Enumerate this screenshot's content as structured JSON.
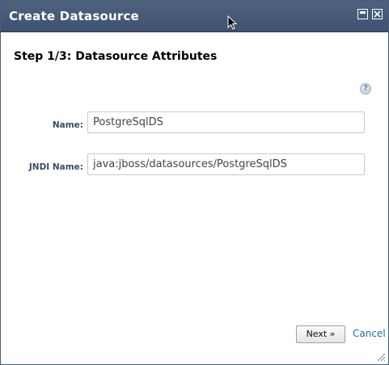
{
  "window": {
    "title": "Create Datasource"
  },
  "wizard": {
    "step_title": "Step 1/3: Datasource Attributes",
    "help_glyph": "?"
  },
  "form": {
    "name_label": "Name:",
    "name_value": "PostgreSqlDS",
    "jndi_label": "JNDI Name:",
    "jndi_value": "java:jboss/datasources/PostgreSqlDS"
  },
  "actions": {
    "next_label": "Next »",
    "cancel_label": "Cancel"
  },
  "icons": {
    "maximize": "maximize-icon",
    "close": "close-icon",
    "help": "help-icon",
    "cursor": "mouse-cursor-icon",
    "resize": "resize-grip-icon"
  },
  "colors": {
    "titlebar": "#44587a",
    "label": "#3a4c66",
    "link": "#1d6aa3"
  }
}
